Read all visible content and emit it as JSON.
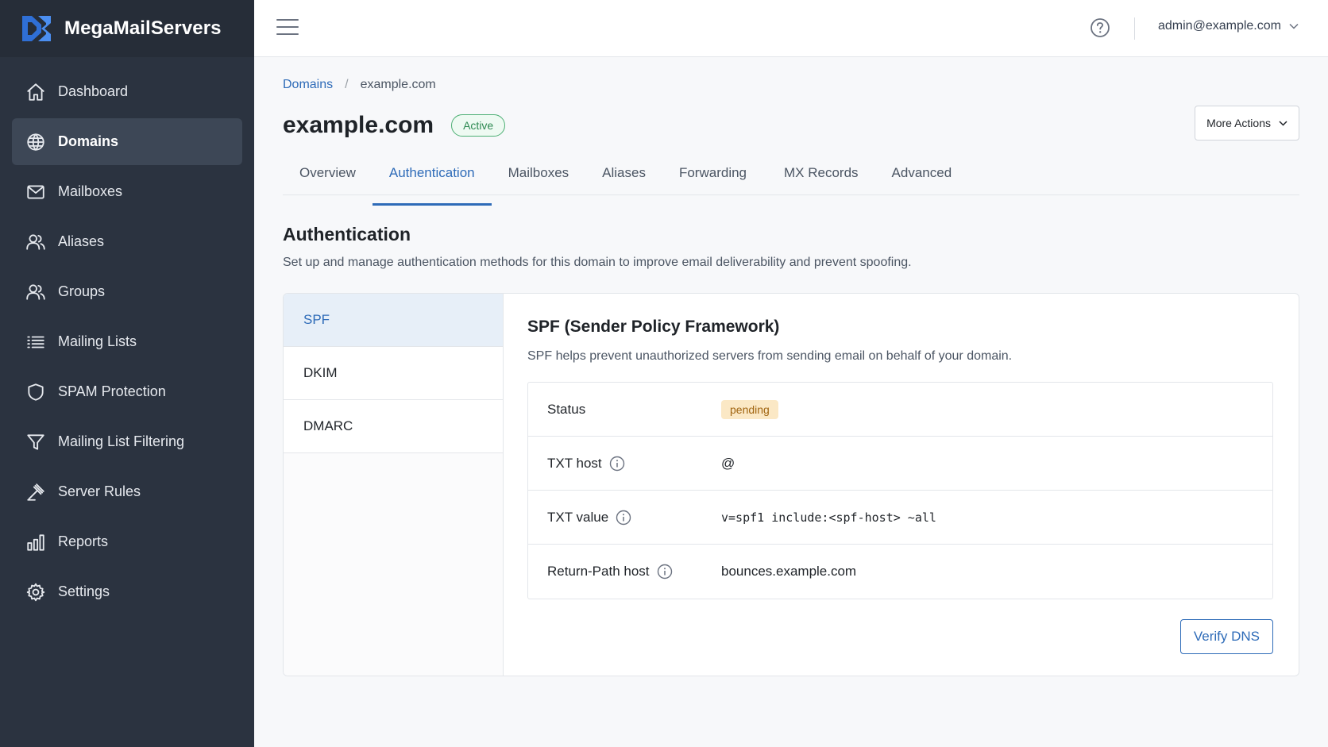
{
  "brand": {
    "name": "MegaMailServers",
    "logo_icon": "brand-logo-icon"
  },
  "sidebar": {
    "items": [
      {
        "label": "Dashboard",
        "icon": "home-icon"
      },
      {
        "label": "Domains",
        "icon": "globe-icon",
        "active": true
      },
      {
        "label": "Mailboxes",
        "icon": "mail-icon"
      },
      {
        "label": "Aliases",
        "icon": "user-icon"
      },
      {
        "label": "Groups",
        "icon": "users-icon"
      },
      {
        "label": "Mailing Lists",
        "icon": "list-icon"
      },
      {
        "label": "SPAM Protection",
        "icon": "shield-icon"
      },
      {
        "label": "Mailing List Filtering",
        "icon": "filter-icon"
      },
      {
        "label": "Server Rules",
        "icon": "gavel-icon"
      },
      {
        "label": "Reports",
        "icon": "bar-chart-icon"
      },
      {
        "label": "Settings",
        "icon": "gear-icon"
      }
    ]
  },
  "topbar": {
    "menu_icon": "hamburger-icon",
    "help_icon": "help-icon",
    "user_email": "admin@example.com"
  },
  "breadcrumb": {
    "parent": "Domains",
    "separator": "/",
    "current": "example.com"
  },
  "page": {
    "title": "example.com",
    "status_badge": "Active",
    "more_actions": "More Actions"
  },
  "tabs": [
    {
      "label": "Overview"
    },
    {
      "label": "Authentication",
      "active": true
    },
    {
      "label": "Mailboxes"
    },
    {
      "label": "Aliases"
    },
    {
      "label": "Forwarding"
    },
    {
      "label": "MX Records"
    },
    {
      "label": "Advanced"
    }
  ],
  "section": {
    "title": "Authentication",
    "description": "Set up and manage authentication methods for this domain to improve email deliverability and prevent spoofing."
  },
  "methods": [
    {
      "label": "SPF",
      "active": true
    },
    {
      "label": "DKIM"
    },
    {
      "label": "DMARC"
    }
  ],
  "detail": {
    "title": "SPF (Sender Policy Framework)",
    "description": "SPF helps prevent unauthorized servers from sending email on behalf of your domain.",
    "rows": [
      {
        "label": "Status",
        "value": "pending"
      },
      {
        "label": "TXT host",
        "value": "@"
      },
      {
        "label": "TXT value",
        "value": "v=spf1 include:<spf-host> ~all"
      },
      {
        "label": "Return-Path host",
        "value": "bounces.example.com"
      }
    ],
    "verify_button": "Verify DNS"
  },
  "colors": {
    "sidebar_bg": "#2b3340",
    "accent": "#2e6bb8",
    "active_green": "#2e8a52",
    "pending_bg": "#fbe8c5"
  }
}
